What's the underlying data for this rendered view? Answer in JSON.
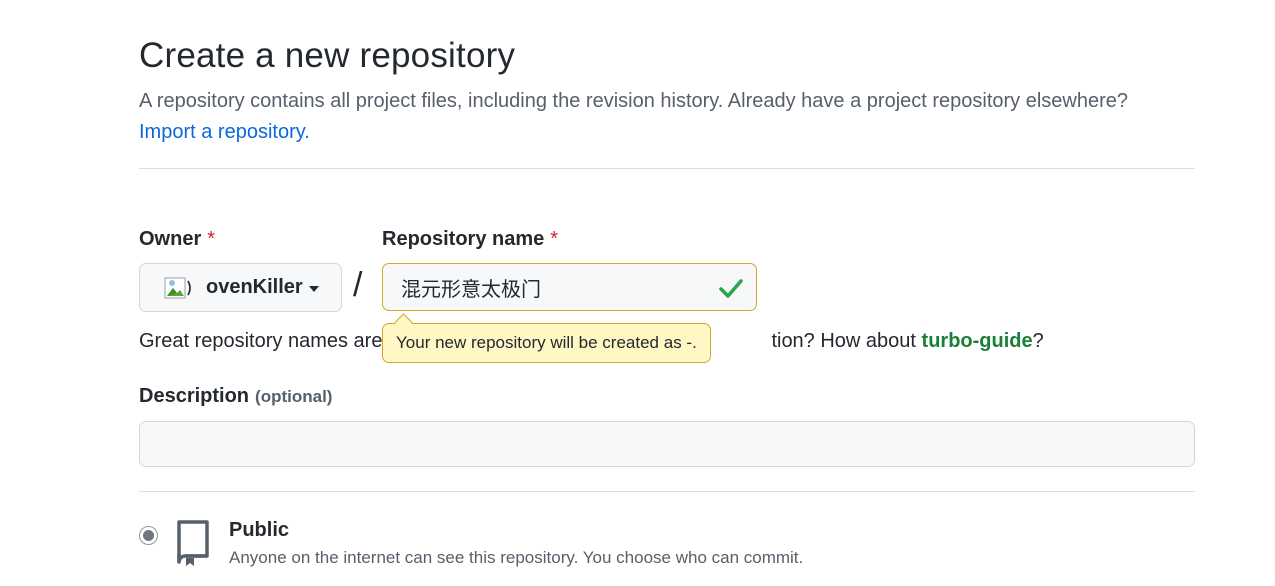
{
  "header": {
    "title": "Create a new repository",
    "subtitle": "A repository contains all project files, including the revision history. Already have a project repository elsewhere?",
    "import_link": "Import a repository."
  },
  "owner": {
    "label": "Owner",
    "required_mark": "*",
    "name": "ovenKiller"
  },
  "separator": "/",
  "repository": {
    "label": "Repository name",
    "required_mark": "*",
    "value": "混元形意太极门"
  },
  "tooltip": {
    "text": "Your new repository will be created as -."
  },
  "hint": {
    "prefix": "Great repository names are",
    "suffix": "tion? How about",
    "suggestion": "turbo-guide",
    "end": "?"
  },
  "description": {
    "label": "Description",
    "optional": "(optional)",
    "value": ""
  },
  "visibility": {
    "public_label": "Public",
    "public_desc": "Anyone on the internet can see this repository. You choose who can commit."
  },
  "colors": {
    "link": "#0969da",
    "success": "#1a7f37",
    "warning_border": "#d4a72c",
    "tooltip_bg": "#fff8c5",
    "required": "#cf222e"
  }
}
